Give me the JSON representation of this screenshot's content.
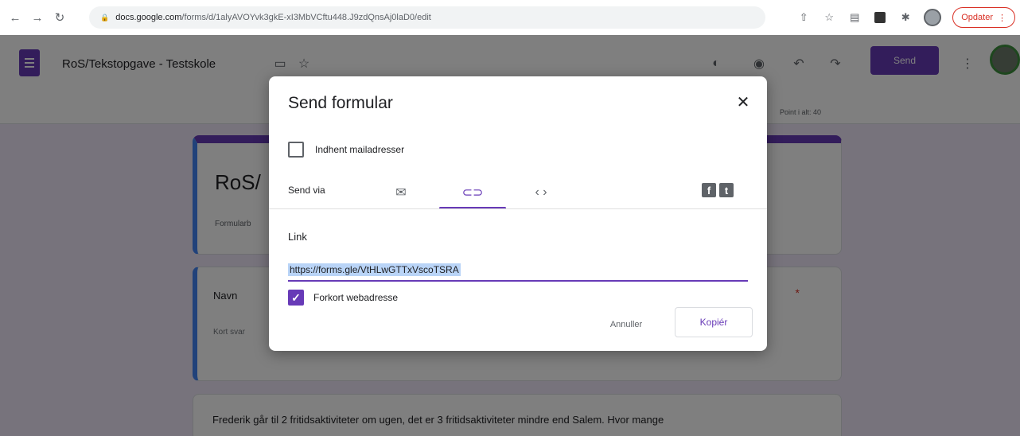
{
  "browser": {
    "url_host": "docs.google.com",
    "url_path": "/forms/d/1alyAVOYvk3gkE-xI3MbVCftu448.J9zdQnsAj0laD0/edit",
    "update_label": "Opdater",
    "icons": [
      "back-icon",
      "forward-icon",
      "reload-icon",
      "share-icon",
      "star-icon",
      "extension-icon",
      "puzzle-icon",
      "profile-icon",
      "menu-icon"
    ]
  },
  "header": {
    "doc_title": "RoS/Tekstopgave - Testskole",
    "send_label": "Send",
    "points_total": "Point i alt: 40"
  },
  "form": {
    "title": "RoS/",
    "description": "Formularb",
    "q1_title": "Navn",
    "q1_required": "*",
    "q1_placeholder": "Kort svar",
    "q2_text": "Frederik går til 2 fritidsaktiviteter om ugen, det er 3 fritidsaktiviteter mindre end Salem. Hvor mange"
  },
  "dialog": {
    "title": "Send formular",
    "collect_emails_label": "Indhent mailadresser",
    "send_via_label": "Send via",
    "link_heading": "Link",
    "link_value": "https://forms.gle/VtHLwGTTxVscoTSRA",
    "shorten_label": "Forkort webadresse",
    "cancel_label": "Annuller",
    "copy_label": "Kopiér"
  },
  "colors": {
    "accent": "#673ab7",
    "link_highlight": "#b9d4f7",
    "required": "#d93025"
  }
}
